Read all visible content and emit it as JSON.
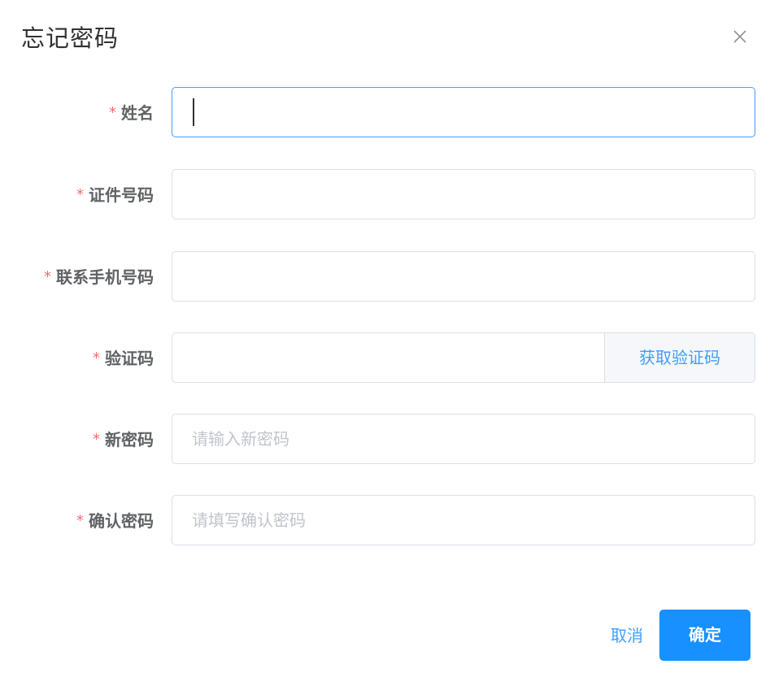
{
  "dialog": {
    "title": "忘记密码",
    "close_icon": "close-icon"
  },
  "form": {
    "required_mark": "*",
    "name": {
      "label": "姓名",
      "value": "",
      "placeholder": ""
    },
    "id_number": {
      "label": "证件号码",
      "value": "",
      "placeholder": ""
    },
    "phone": {
      "label": "联系手机号码",
      "value": "",
      "placeholder": ""
    },
    "verify_code": {
      "label": "验证码",
      "value": "",
      "placeholder": "",
      "get_code_label": "获取验证码"
    },
    "new_password": {
      "label": "新密码",
      "value": "",
      "placeholder": "请输入新密码"
    },
    "confirm_password": {
      "label": "确认密码",
      "value": "",
      "placeholder": "请填写确认密码"
    }
  },
  "footer": {
    "cancel_label": "取消",
    "confirm_label": "确定"
  },
  "colors": {
    "primary": "#409eff",
    "confirm_bg": "#1890ff",
    "required": "#f56c6c",
    "border": "#dcdfe6",
    "focus_border": "#409eff"
  }
}
